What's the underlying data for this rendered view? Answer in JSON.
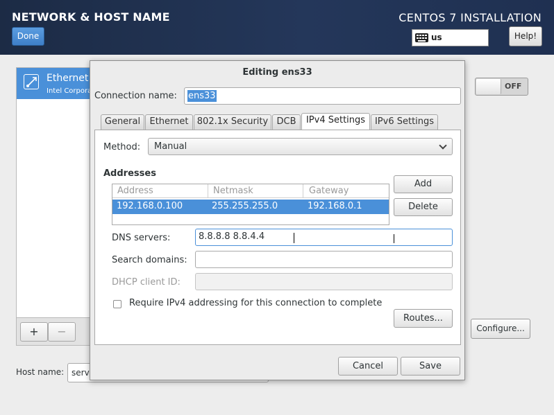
{
  "header": {
    "title": "NETWORK & HOST NAME",
    "done_label": "Done",
    "product": "CENTOS 7 INSTALLATION",
    "keyboard_layout": "us",
    "help_label": "Help!",
    "keyboard_icon": "keyboard-icon"
  },
  "devices": {
    "items": [
      {
        "name": "Ethernet",
        "description": "Intel Corporation",
        "icon": "network-wired-icon"
      }
    ],
    "add_label": "+",
    "remove_label": "−"
  },
  "toggle": {
    "state_label": "OFF"
  },
  "configure_label": "Configure...",
  "hostname": {
    "label": "Host name:",
    "value": "serv"
  },
  "dialog": {
    "title": "Editing ens33",
    "connection_name_label": "Connection name:",
    "connection_name_value": "ens33",
    "tabs": [
      {
        "label": "General"
      },
      {
        "label": "Ethernet"
      },
      {
        "label": "802.1x Security"
      },
      {
        "label": "DCB"
      },
      {
        "label": "IPv4 Settings"
      },
      {
        "label": "IPv6 Settings"
      }
    ],
    "active_tab": "IPv4 Settings",
    "ipv4": {
      "method_label": "Method:",
      "method_value": "Manual",
      "addresses_heading": "Addresses",
      "columns": [
        "Address",
        "Netmask",
        "Gateway"
      ],
      "rows": [
        {
          "address": "192.168.0.100",
          "netmask": "255.255.255.0",
          "gateway": "192.168.0.1"
        }
      ],
      "add_label": "Add",
      "delete_label": "Delete",
      "dns_label": "DNS servers:",
      "dns_value": "8.8.8.8 8.8.4.4",
      "search_label": "Search domains:",
      "search_value": "",
      "dhcp_label": "DHCP client ID:",
      "dhcp_value": "",
      "require_label": "Require IPv4 addressing for this connection to complete",
      "require_checked": false,
      "routes_label": "Routes..."
    },
    "cancel_label": "Cancel",
    "save_label": "Save"
  },
  "colors": {
    "header_bg": "#1f3051",
    "accent": "#4a90d9"
  }
}
